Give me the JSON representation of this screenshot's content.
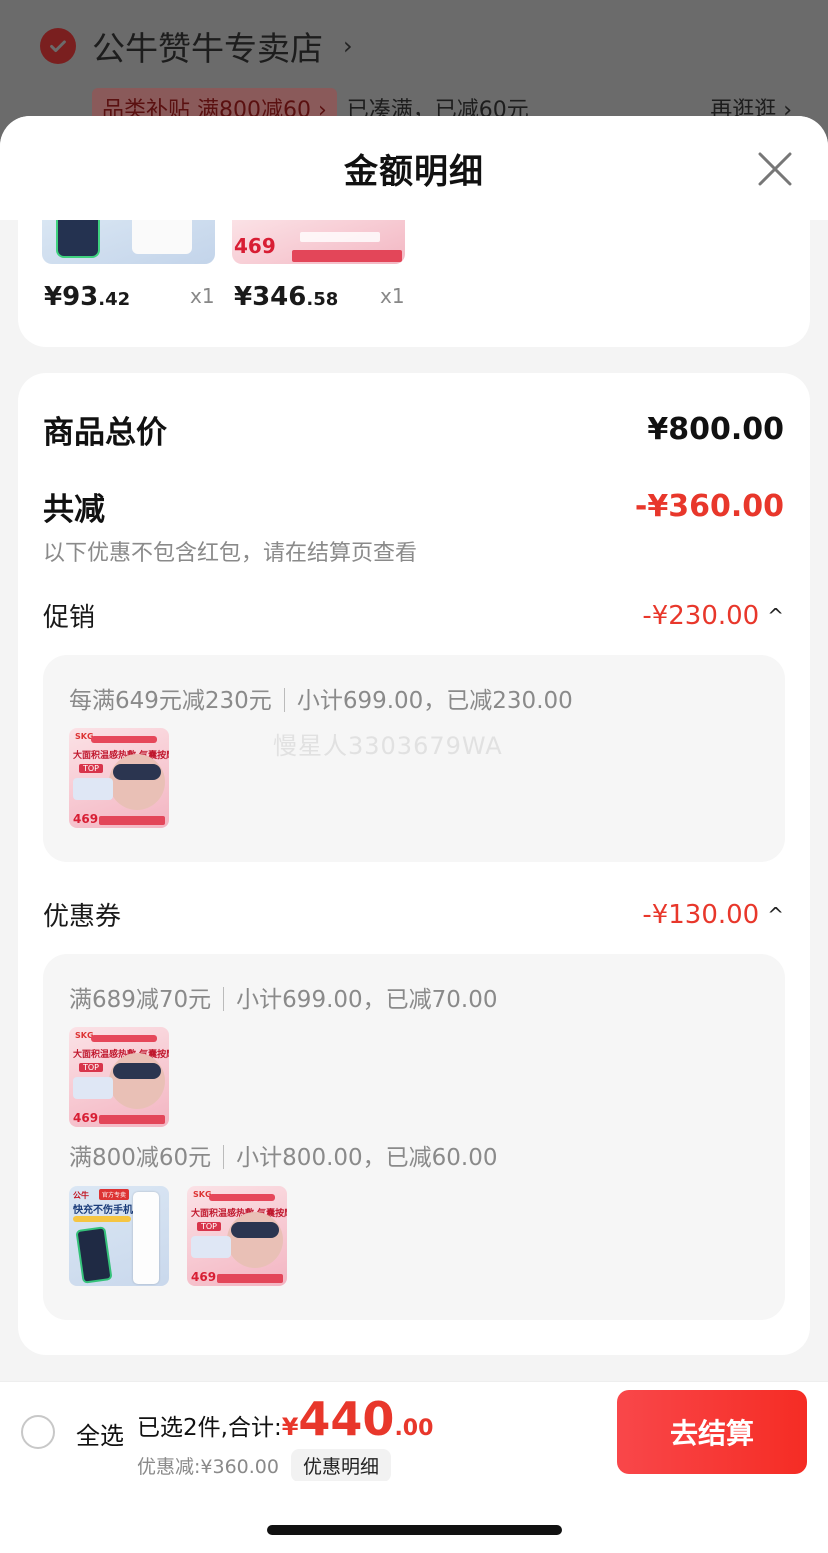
{
  "background": {
    "store_name": "公牛赞牛专卖店",
    "promo_tag": "品类补贴 满800减60 ›",
    "promo_status": "已凑满，已减60元",
    "more_link": "再逛逛 ›"
  },
  "sheet": {
    "title": "金额明细",
    "close_icon": "close-icon"
  },
  "strip_items": [
    {
      "price_int": "¥93",
      "price_dec": ".42",
      "qty": "x1",
      "image": "cable-product"
    },
    {
      "price_int": "¥346",
      "price_dec": ".58",
      "qty": "x1",
      "image": "eye-mask-product"
    }
  ],
  "summary": {
    "total_label": "商品总价",
    "total_value": "¥800.00",
    "reduce_label": "共减",
    "reduce_value": "-¥360.00",
    "reduce_note": "以下优惠不包含红包，请在结算页查看"
  },
  "promotion": {
    "label": "促销",
    "value": "-¥230.00",
    "rule": "每满649元减230元",
    "detail": "小计699.00，已减230.00"
  },
  "coupon": {
    "label": "优惠券",
    "value": "-¥130.00",
    "rule1": "满689减70元",
    "detail1": "小计699.00，已减70.00",
    "rule2": "满800减60元",
    "detail2": "小计800.00，已减60.00"
  },
  "watermark": "慢星人3303679WA",
  "bottom_bar": {
    "select_all": "全选",
    "selected_label": "已选2件,合计:",
    "currency": "¥",
    "total_int": "440",
    "total_dec": ".00",
    "discount_text": "优惠减:¥360.00",
    "discount_detail_button": "优惠明细",
    "checkout_button": "去结算"
  },
  "product_art": {
    "mask_brand": "SKG",
    "mask_headline": "大面积温感热敷 气囊按摩",
    "mask_badge": "TOP",
    "mask_price": "469",
    "cable_brand": "公牛",
    "cable_tag": "官方专卖",
    "cable_headline": "快充不伤手机"
  },
  "colors": {
    "accent_red": "#e8372b",
    "checkout_gradient_start": "#f9474a",
    "checkout_gradient_end": "#f52c24"
  }
}
